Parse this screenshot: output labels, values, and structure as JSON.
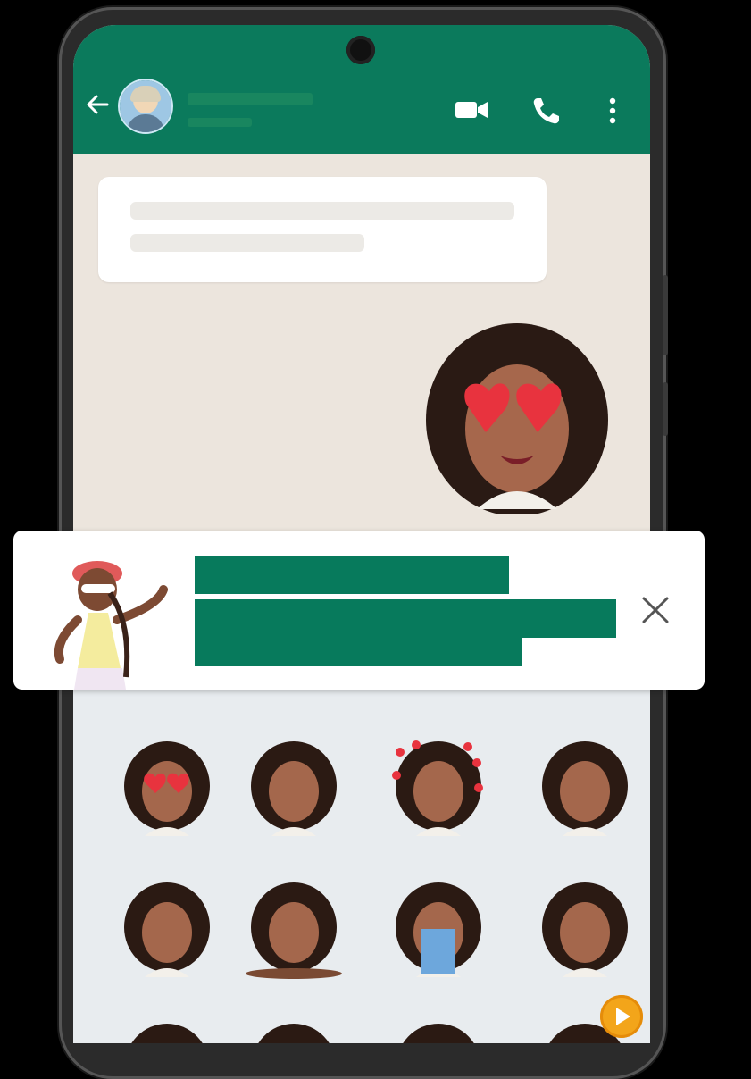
{
  "header": {
    "contact_name": "",
    "contact_status": "",
    "icons": [
      "back-arrow-icon",
      "video-call-icon",
      "voice-call-icon",
      "more-vert-icon"
    ],
    "color": "#0b7a5c"
  },
  "chat": {
    "incoming_message": "",
    "sent_sticker": "heart-eyes-avatar-sticker"
  },
  "notification": {
    "lines": [
      "",
      "",
      ""
    ],
    "close_icon": "close-icon",
    "accent": "#077a5c"
  },
  "sticker_tray": {
    "stickers": [
      "heart-eyes",
      "thinking",
      "hearts-around",
      "shocked",
      "sip-cup",
      "lying-down",
      "crying",
      "smirk",
      "partial-1",
      "partial-2",
      "partial-3",
      "partial-4"
    ]
  }
}
